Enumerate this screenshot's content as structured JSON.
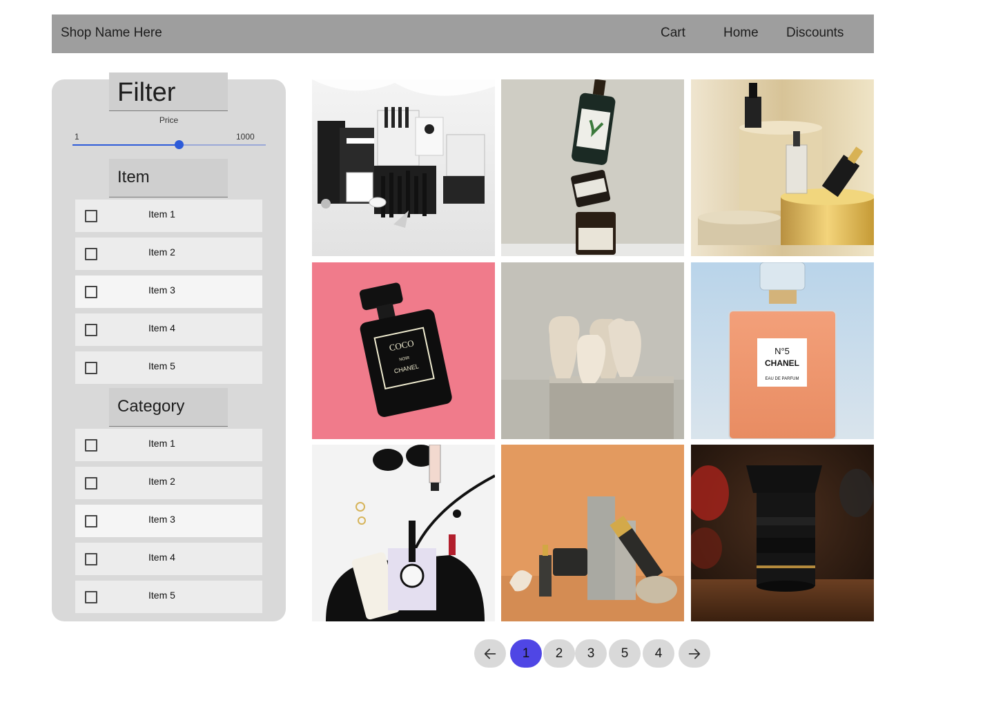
{
  "header": {
    "shop_name": "Shop Name Here",
    "nav": {
      "cart": "Cart",
      "home": "Home",
      "discounts": "Discounts"
    }
  },
  "filter": {
    "title": "Filter",
    "price": {
      "label": "Price",
      "min_label": "1",
      "max_label": "1000",
      "slider_fraction": 0.55
    },
    "item_section": {
      "title": "Item",
      "options": [
        "Item 1",
        "Item 2",
        "Item 3",
        "Item 4",
        "Item 5"
      ]
    },
    "category_section": {
      "title": "Category",
      "options": [
        "Item 1",
        "Item 2",
        "Item 3",
        "Item 4",
        "Item 5"
      ]
    }
  },
  "products": {
    "tiles": [
      {
        "icon": "cosmetics-set-image"
      },
      {
        "icon": "stacked-jars-image"
      },
      {
        "icon": "gold-podium-bottles-image"
      },
      {
        "icon": "black-perfume-image"
      },
      {
        "icon": "ceramic-vases-image"
      },
      {
        "icon": "chanel-perfume-image"
      },
      {
        "icon": "handbag-flatlay-image"
      },
      {
        "icon": "skincare-orange-image"
      },
      {
        "icon": "camera-lens-image"
      }
    ],
    "bottle_text": {
      "coco": "COCO",
      "noir": "NOIR",
      "chanel": "CHANEL",
      "no5": "N°5",
      "chanel2": "CHANEL",
      "edp": "EAU DE PARFUM"
    }
  },
  "pagination": {
    "pages": [
      "1",
      "2",
      "3",
      "5",
      "4"
    ],
    "active": "1"
  },
  "colors": {
    "header_bg": "#9e9e9e",
    "panel_bg": "#d9d9d9",
    "accent": "#4f46e5",
    "slider": "#2d5bd9"
  }
}
